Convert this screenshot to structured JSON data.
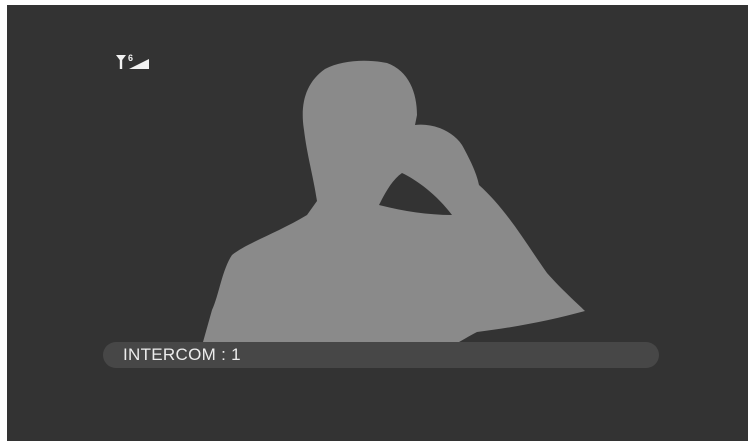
{
  "screen": {
    "background_color": "#333333",
    "silhouette_color": "#8a8a8a",
    "status_bar_color": "#474747",
    "status_text_color": "#ececec"
  },
  "signal": {
    "icon": "signal-strength-icon",
    "level_text": "6"
  },
  "caller_image": {
    "icon": "person-on-phone-silhouette"
  },
  "status": {
    "label": "INTERCOM : 1"
  }
}
